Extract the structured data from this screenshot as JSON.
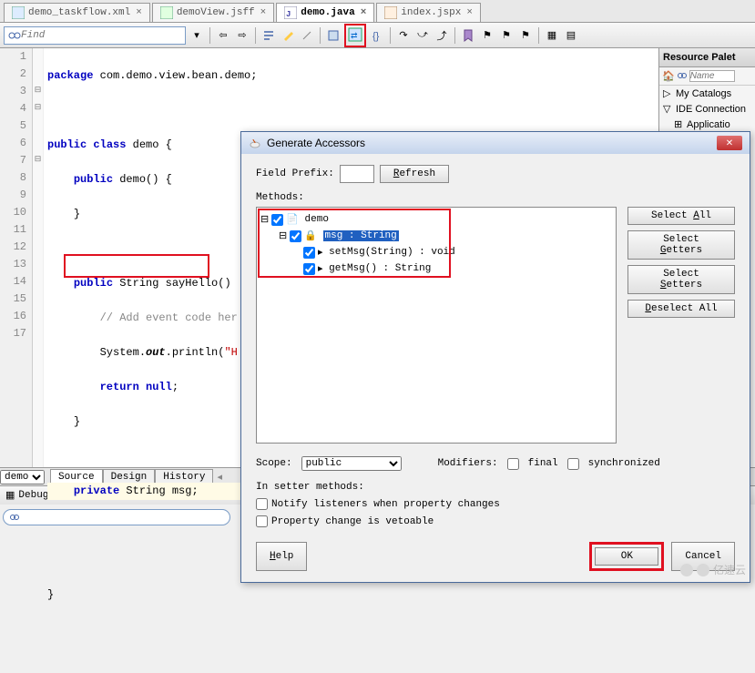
{
  "tabs": [
    {
      "label": "demo_taskflow.xml"
    },
    {
      "label": "demoView.jsff"
    },
    {
      "label": "demo.java",
      "active": true
    },
    {
      "label": "index.jspx"
    }
  ],
  "find_placeholder": "Find",
  "code_lines": {
    "l1": "package com.demo.view.bean.demo;",
    "l3_a": "public",
    "l3_b": "class",
    "l3_c": " demo {",
    "l4_a": "public",
    "l4_b": " demo() {",
    "l5": "}",
    "l7_a": "public",
    "l7_b": " String sayHello()",
    "l8": "// Add event code her",
    "l9_a": "System.",
    "l9_b": "out",
    "l9_c": ".println(",
    "l9_d": "\"H",
    "l10_a": "return",
    "l10_b": "null",
    "l10_c": ";",
    "l11": "}",
    "l13_a": "private",
    "l13_b": " String msg;",
    "l16": "}"
  },
  "line_numbers": [
    "1",
    "2",
    "3",
    "4",
    "5",
    "6",
    "7",
    "8",
    "9",
    "10",
    "11",
    "12",
    "13",
    "14",
    "15",
    "16",
    "17"
  ],
  "bottom_dropdown": "demo",
  "bottom_tabs": [
    "Source",
    "Design",
    "History"
  ],
  "debugging_label": "Debugging: IntegratedWebLogicServer - Lo",
  "resource_panel": {
    "title": "Resource Palet",
    "search_placeholder": "Name",
    "items": [
      "My Catalogs",
      "IDE Connection",
      "Applicatio"
    ]
  },
  "dialog": {
    "title": "Generate Accessors",
    "field_prefix_label": "Field Prefix:",
    "refresh": "Refresh",
    "methods_label": "Methods:",
    "tree": {
      "root": "demo",
      "field": "msg : String",
      "setter": "setMsg(String) : void",
      "getter": "getMsg() : String"
    },
    "select_all": "Select All",
    "select_getters": "Select Getters",
    "select_setters": "Select Setters",
    "deselect_all": "Deselect All",
    "scope_label": "Scope:",
    "scope_value": "public",
    "modifiers_label": "Modifiers:",
    "final": "final",
    "synchronized": "synchronized",
    "setter_methods_label": "In setter methods:",
    "notify": "Notify listeners when property changes",
    "vetoable": "Property change is vetoable",
    "help": "Help",
    "ok": "OK",
    "cancel": "Cancel"
  },
  "watermark": "亿速云"
}
